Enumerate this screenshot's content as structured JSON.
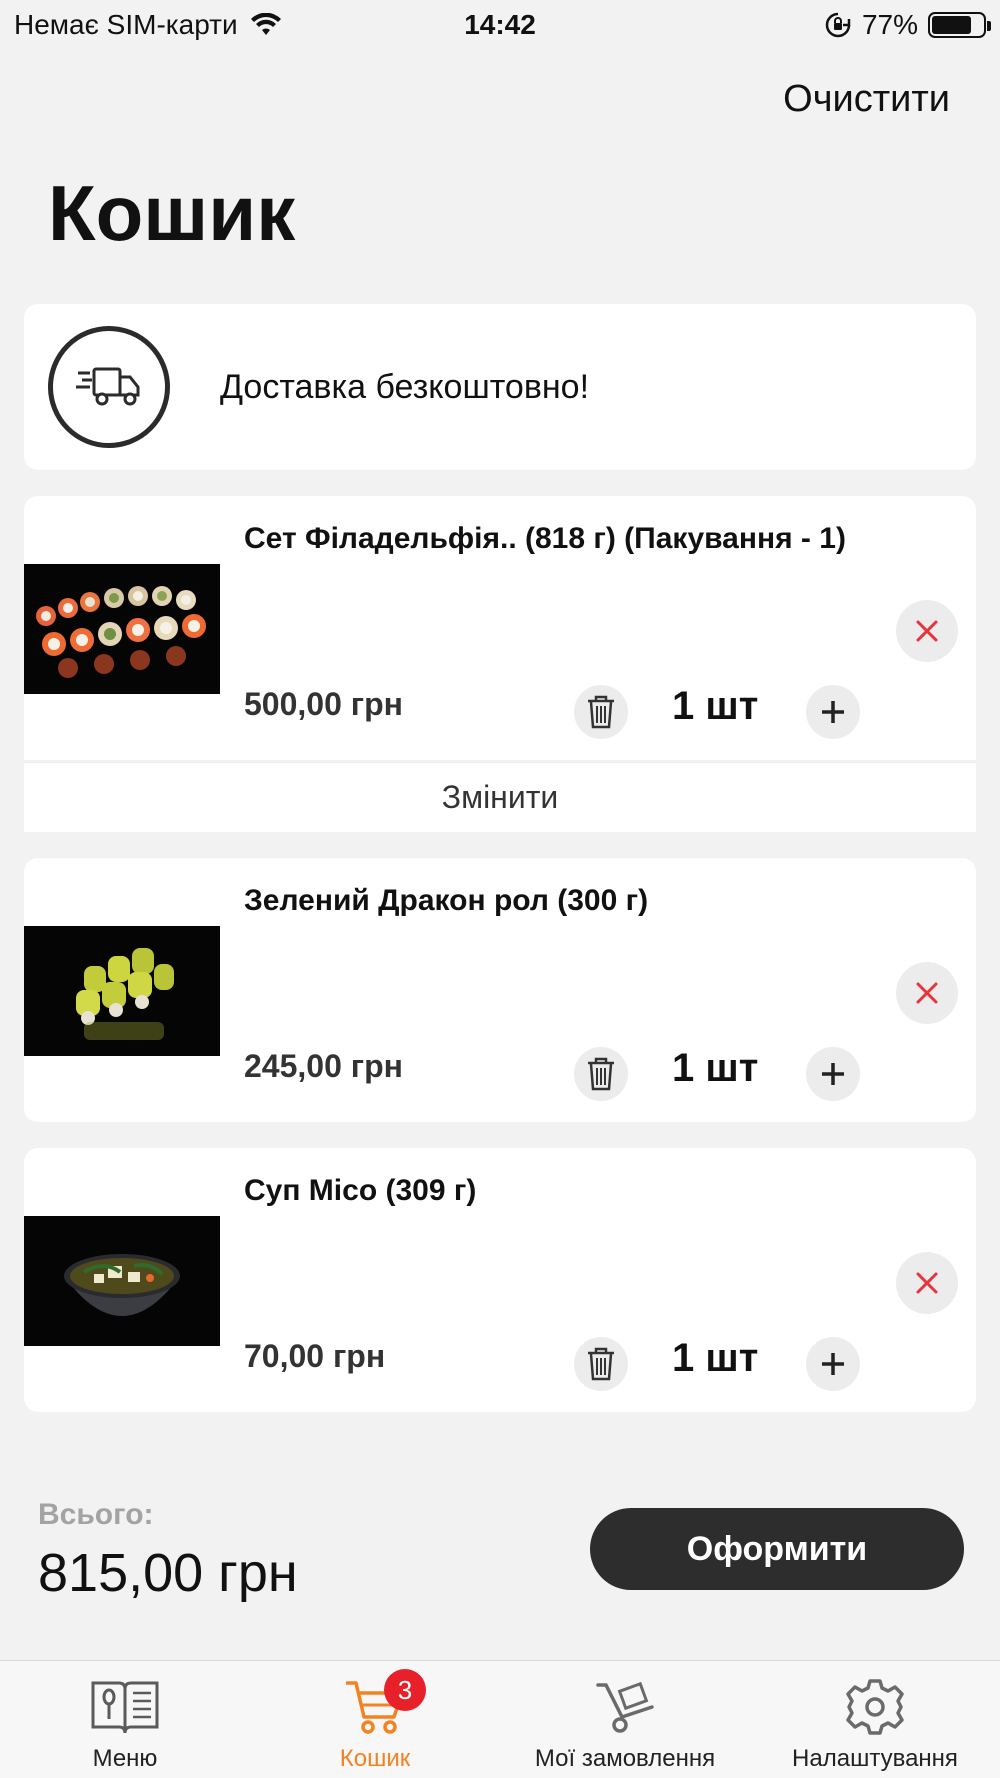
{
  "status_bar": {
    "carrier": "Немає SIM-карти",
    "time": "14:42",
    "battery_percent": "77%",
    "battery_level": 0.77
  },
  "header": {
    "clear_label": "Очистити",
    "title": "Кошик"
  },
  "delivery": {
    "icon": "delivery-truck-icon",
    "text": "Доставка безкоштовно!"
  },
  "cart_items": [
    {
      "title": "Сет Філадельфія.. (818 г) (Пакування - 1)",
      "price": "500,00 грн",
      "quantity": "1 шт",
      "image": "sushi-set-philadelphia",
      "edit_label": "Змінити"
    },
    {
      "title": "Зелений Дракон рол (300 г)",
      "price": "245,00 грн",
      "quantity": "1 шт",
      "image": "green-dragon-roll"
    },
    {
      "title": "Суп Місо (309 г)",
      "price": "70,00 грн",
      "quantity": "1 шт",
      "image": "miso-soup"
    }
  ],
  "summary": {
    "total_label": "Всього:",
    "total_value": "815,00 грн",
    "checkout_label": "Оформити"
  },
  "tab_bar": {
    "tabs": [
      {
        "label": "Меню",
        "icon": "menu-book-icon"
      },
      {
        "label": "Кошик",
        "icon": "cart-icon",
        "badge": "3",
        "active": true
      },
      {
        "label": "Мої замовлення",
        "icon": "hand-truck-icon"
      },
      {
        "label": "Налаштування",
        "icon": "gear-icon"
      }
    ]
  },
  "colors": {
    "background": "#f2f2f2",
    "accent": "#f58220",
    "badge": "#e8202a",
    "remove": "#e8333b",
    "button_dark": "#2d2d2d"
  }
}
